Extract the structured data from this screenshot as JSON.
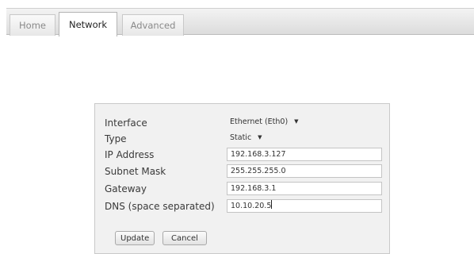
{
  "tabs": [
    {
      "label": "Home",
      "active": false
    },
    {
      "label": "Network",
      "active": true
    },
    {
      "label": "Advanced",
      "active": false
    }
  ],
  "form": {
    "interface": {
      "label": "Interface",
      "value": "Ethernet (Eth0)",
      "icon": "dropdown-arrow-icon"
    },
    "type": {
      "label": "Type",
      "value": "Static",
      "icon": "dropdown-arrow-icon"
    },
    "ip_address": {
      "label": "IP Address",
      "value": "192.168.3.127"
    },
    "subnet_mask": {
      "label": "Subnet Mask",
      "value": "255.255.255.0"
    },
    "gateway": {
      "label": "Gateway",
      "value": "192.168.3.1"
    },
    "dns": {
      "label": "DNS (space separated)",
      "value": "10.10.20.5"
    }
  },
  "buttons": {
    "update_label": "Update",
    "cancel_label": "Cancel"
  },
  "colors": {
    "tabbar_bg": "#e4e4e4",
    "panel_bg": "#f1f1f1",
    "active_tab_bg": "#ffffff"
  }
}
